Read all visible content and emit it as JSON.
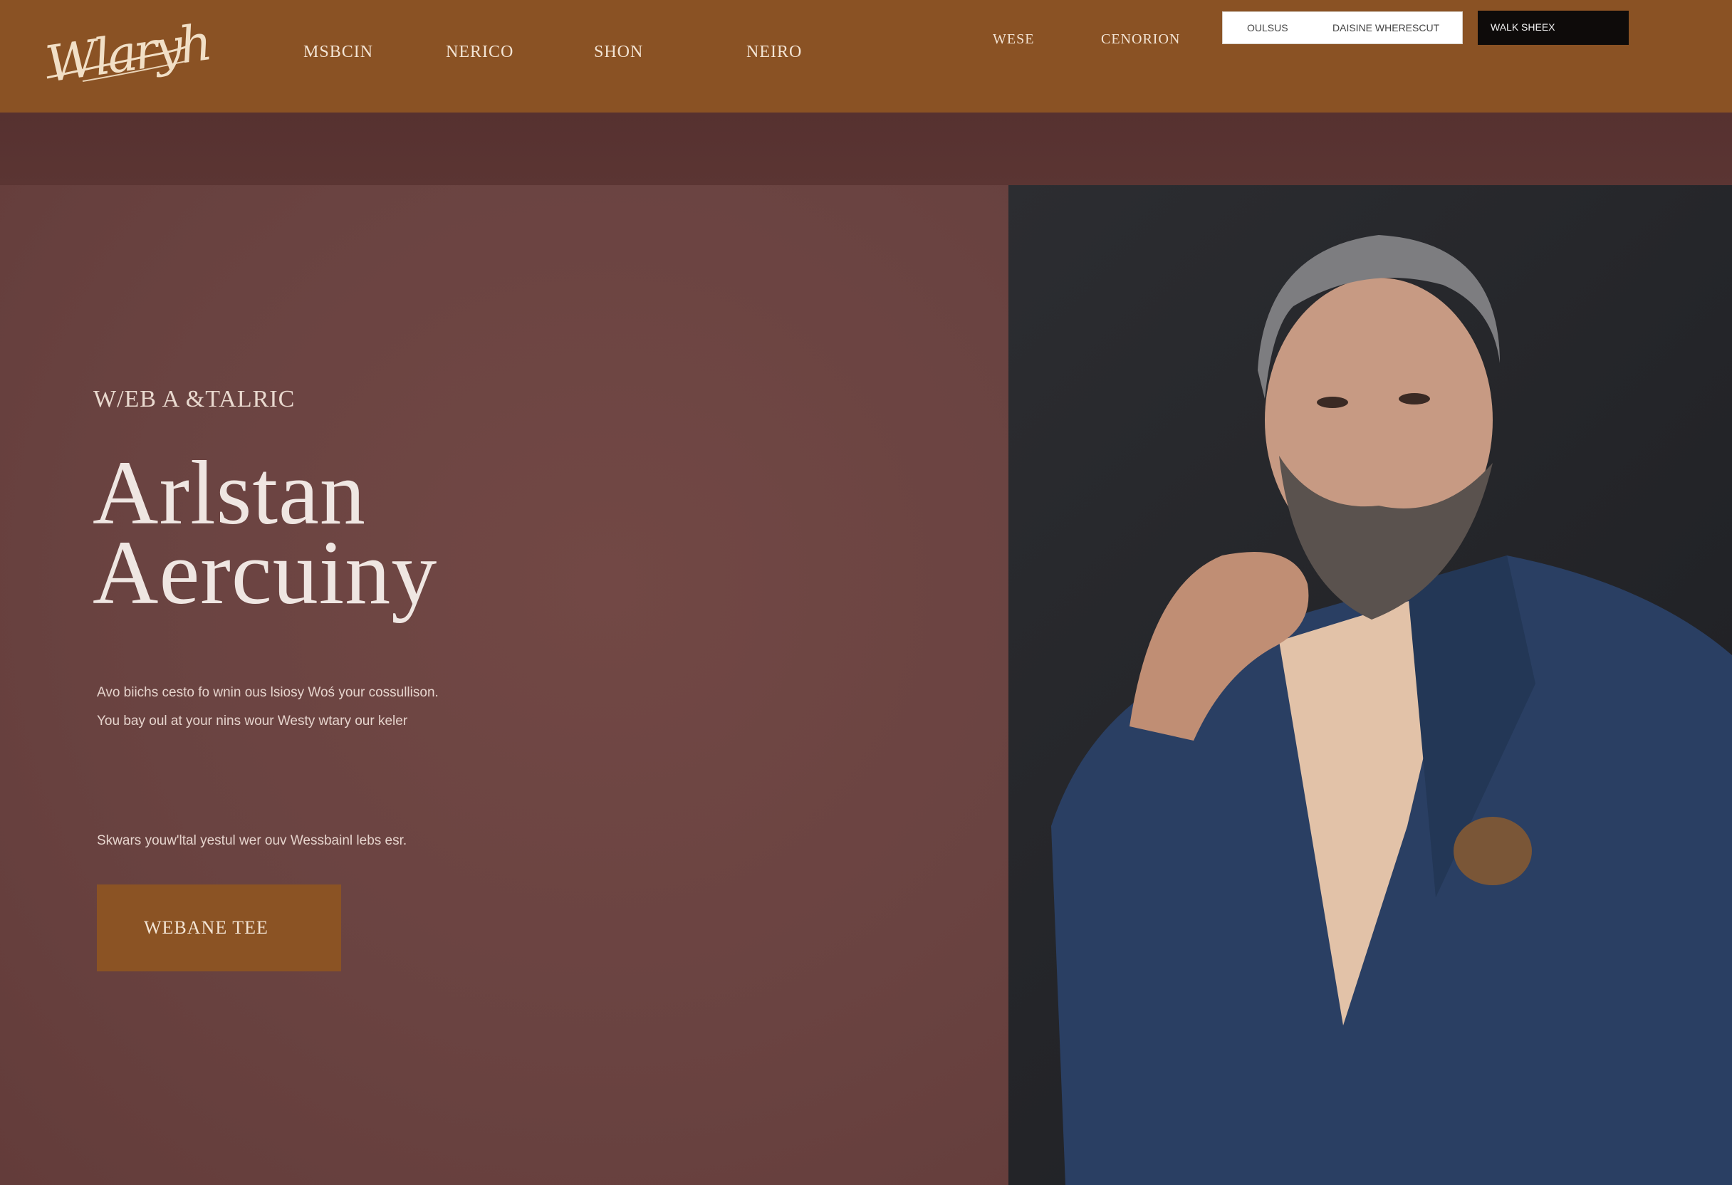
{
  "header": {
    "logo_text": "Wlaryh",
    "nav": [
      "MSBCIN",
      "NERICO",
      "SHON",
      "NEIRO"
    ],
    "secondary_nav": [
      "WESE",
      "CENORION"
    ],
    "search": {
      "left_label": "OULSUS",
      "right_label": "DAISINE   WHERESCUT"
    },
    "cta_label": "WALK SHEEX"
  },
  "hero": {
    "eyebrow": "W/EB A &TALRIC",
    "headline_line1": "Arlstan",
    "headline_line2": "Aercuiny",
    "body_line1": "Avo biichs cesto fo wnin ous lsiosy Woś your cossullison.",
    "body_line2": "You bay oul at your nins wour Westy wtary our keler",
    "body_line3": "Skwars youw'ltal yestul wer ouv Wessbainl lebs esr.",
    "button_label": "WEBANE TEE"
  },
  "colors": {
    "header_bg": "#8a5224",
    "band_bg": "#5a3432",
    "hero_left_bg": "#6b4442",
    "accent": "#8b5324",
    "photo_bg": "#26272b"
  },
  "icons": {
    "portrait": "portrait-image"
  }
}
